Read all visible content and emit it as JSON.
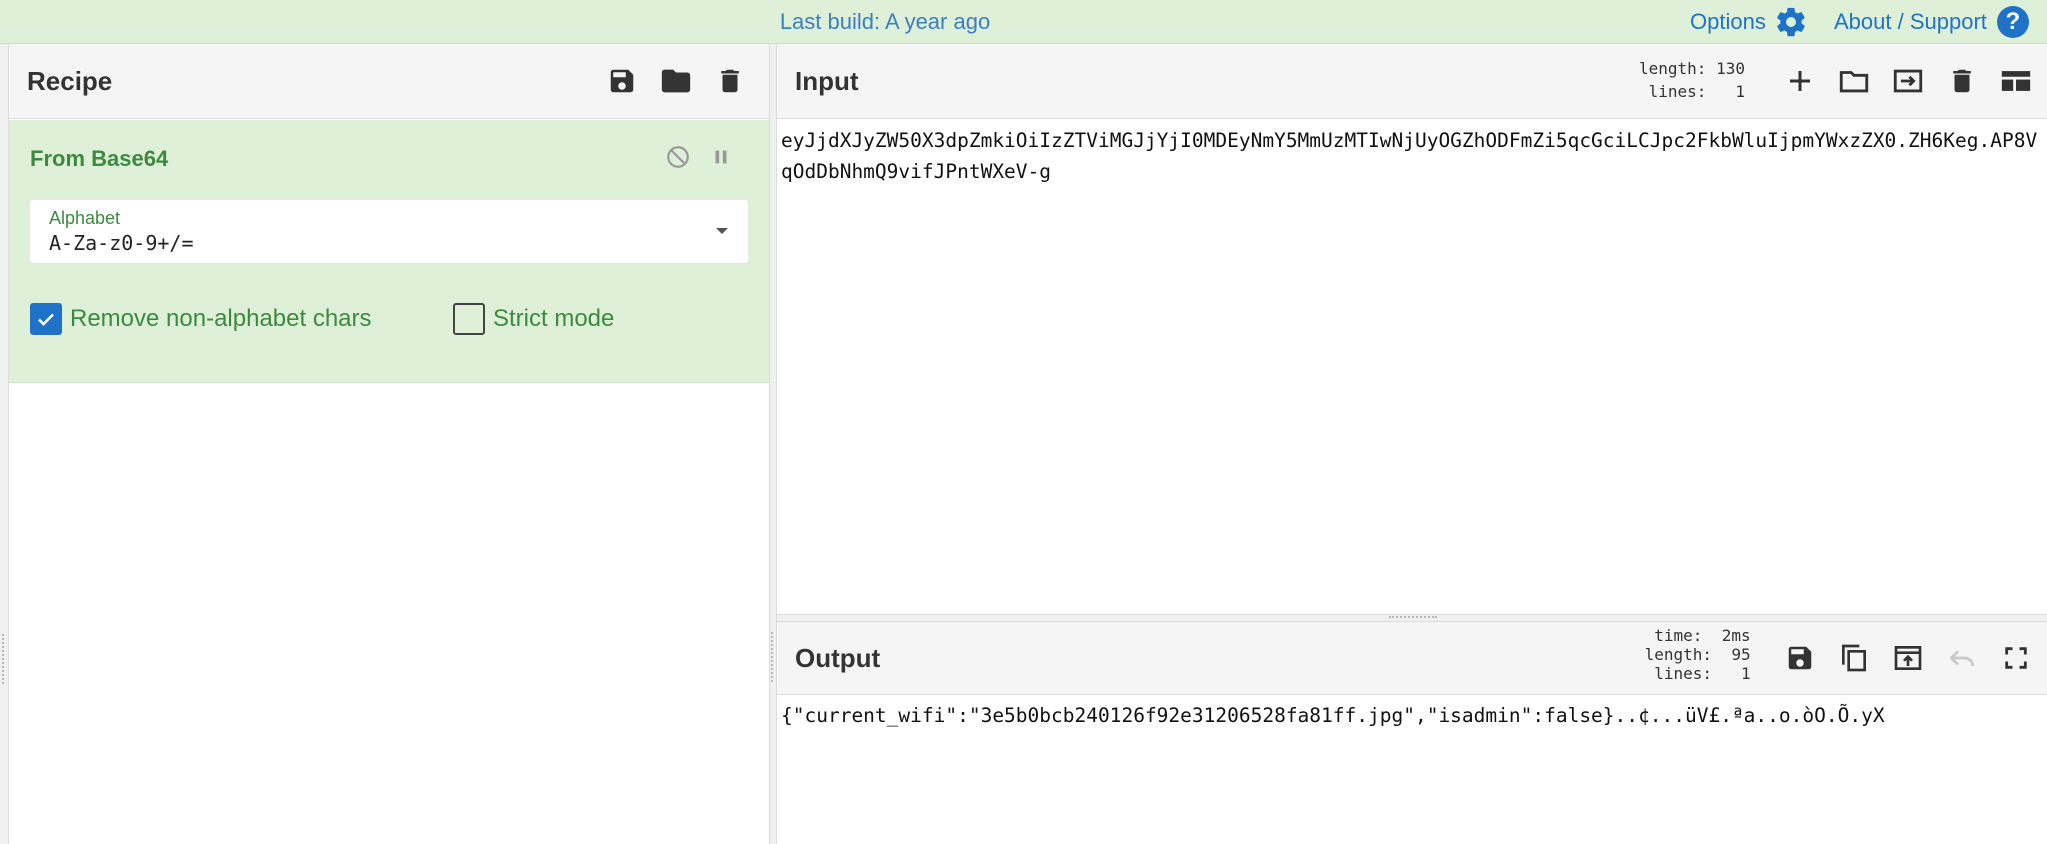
{
  "banner": {
    "build_text": "Last build: A year ago",
    "options_label": "Options",
    "about_label": "About / Support",
    "help_glyph": "?"
  },
  "recipe": {
    "title": "Recipe",
    "icons": [
      "save-icon",
      "folder-icon",
      "trash-icon"
    ],
    "operation": {
      "name": "From Base64",
      "alphabet_label": "Alphabet",
      "alphabet_value": "A-Za-z0-9+/=",
      "remove_non_alphabet_label": "Remove non-alphabet chars",
      "remove_non_alphabet_checked": true,
      "strict_mode_label": "Strict mode",
      "strict_mode_checked": false
    }
  },
  "input": {
    "title": "Input",
    "stats": "length: 130\n lines:   1",
    "text": "eyJjdXJyZW50X3dpZmkiOiIzZTViMGJjYjI0MDEyNmY5MmUzMTIwNjUyOGZhODFmZi5qcGciLCJpc2FkbWluIjpmYWxzZX0.ZH6Keg.AP8VqOdDbNhmQ9vifJPntWXeV-g"
  },
  "output": {
    "title": "Output",
    "stats": "  time:  2ms\nlength:  95\n lines:   1",
    "text": "{\"current_wifi\":\"3e5b0bcb240126f92e31206528fa81ff.jpg\",\"isadmin\":false}..¢...üV£.ªa..o.òO.Õ.yX"
  },
  "colors": {
    "banner_bg": "#dff0d8",
    "accent_blue": "#1e73c8",
    "op_green_text": "#3c8a3f",
    "op_bg": "#dff0d8"
  }
}
